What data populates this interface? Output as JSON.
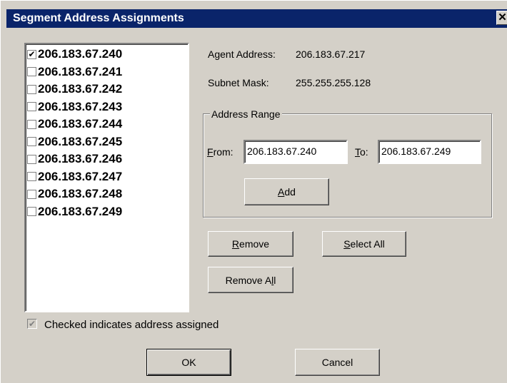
{
  "window": {
    "title": "Segment Address Assignments",
    "close_glyph": "✕"
  },
  "address_list": {
    "check_glyph": "✔",
    "items": [
      {
        "ip": "206.183.67.240",
        "checked": true
      },
      {
        "ip": "206.183.67.241",
        "checked": false
      },
      {
        "ip": "206.183.67.242",
        "checked": false
      },
      {
        "ip": "206.183.67.243",
        "checked": false
      },
      {
        "ip": "206.183.67.244",
        "checked": false
      },
      {
        "ip": "206.183.67.245",
        "checked": false
      },
      {
        "ip": "206.183.67.246",
        "checked": false
      },
      {
        "ip": "206.183.67.247",
        "checked": false
      },
      {
        "ip": "206.183.67.248",
        "checked": false
      },
      {
        "ip": "206.183.67.249",
        "checked": false
      }
    ]
  },
  "agent": {
    "address_label": "Agent Address:",
    "address_value": "206.183.67.217",
    "mask_label": "Subnet Mask:",
    "mask_value": "255.255.255.128"
  },
  "range": {
    "group_title": "Address Range",
    "from_label_key": "F",
    "from_label_rest": "rom:",
    "from_value": "206.183.67.240",
    "to_label_key": "T",
    "to_label_rest": "o:",
    "to_value": "206.183.67.249",
    "add_key": "A",
    "add_rest": "dd"
  },
  "actions": {
    "remove_key": "R",
    "remove_rest": "emove",
    "select_all_key": "S",
    "select_all_rest": "elect All",
    "remove_all_pre": "Remove A",
    "remove_all_key": "l",
    "remove_all_post": "l"
  },
  "footer": {
    "legend_checked": true,
    "legend_text": "Checked indicates address assigned",
    "ok_label": "OK",
    "cancel_label": "Cancel"
  }
}
